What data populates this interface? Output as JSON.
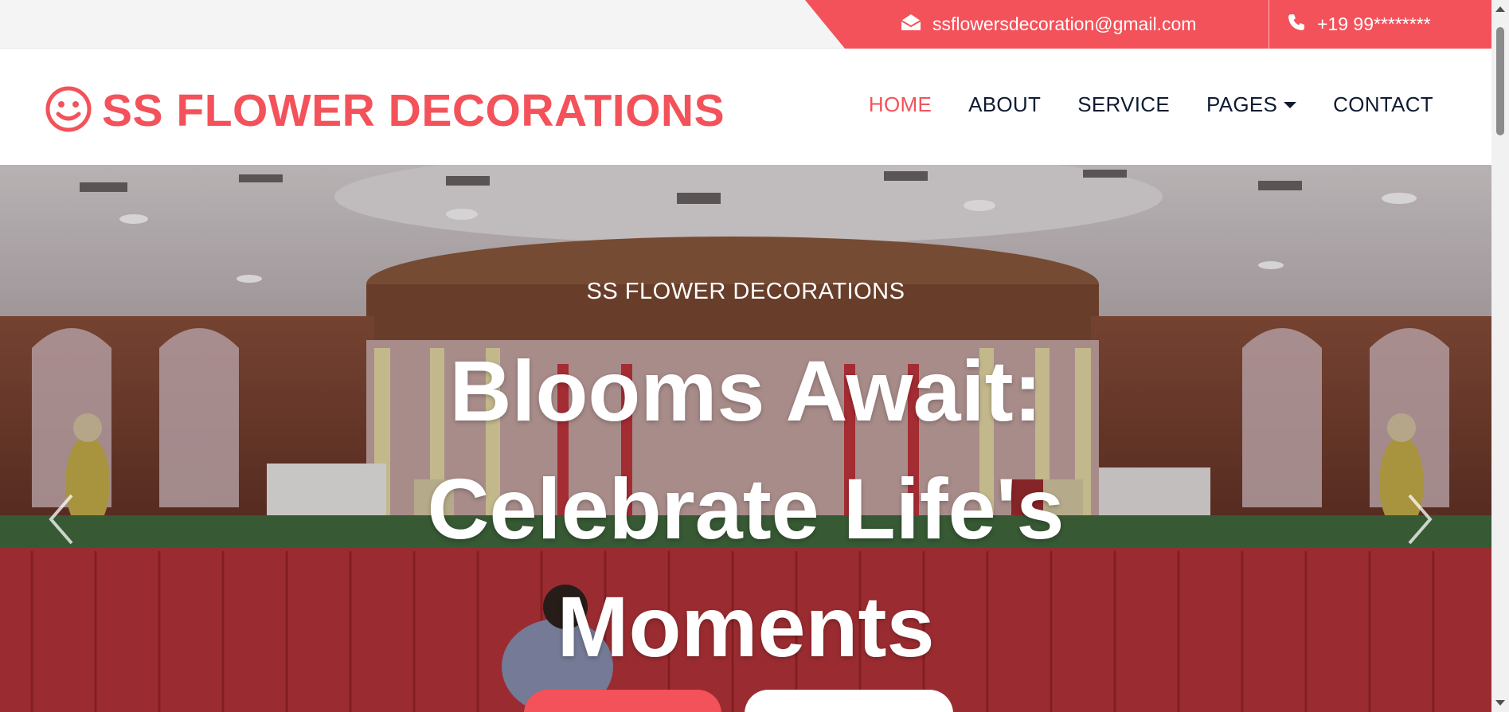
{
  "topbar": {
    "email": "ssflowersdecoration@gmail.com",
    "phone": "+19 99********",
    "email_icon": "envelope-open-icon",
    "phone_icon": "phone-icon"
  },
  "brand": {
    "name": "SS FLOWER DECORATIONS",
    "logo_icon": "smile-icon"
  },
  "nav": {
    "items": [
      {
        "label": "HOME",
        "active": true
      },
      {
        "label": "ABOUT"
      },
      {
        "label": "SERVICE"
      },
      {
        "label": "PAGES",
        "dropdown": true
      },
      {
        "label": "CONTACT"
      }
    ]
  },
  "hero": {
    "subtitle": "SS FLOWER DECORATIONS",
    "title_lines": [
      "Blooms Await:",
      "Celebrate Life's",
      "Moments"
    ],
    "prev_icon": "chevron-left-icon",
    "next_icon": "chevron-right-icon"
  },
  "colors": {
    "accent": "#f3525a",
    "nav_text": "#0f1b33",
    "topbar_bg": "#f4f4f4"
  }
}
